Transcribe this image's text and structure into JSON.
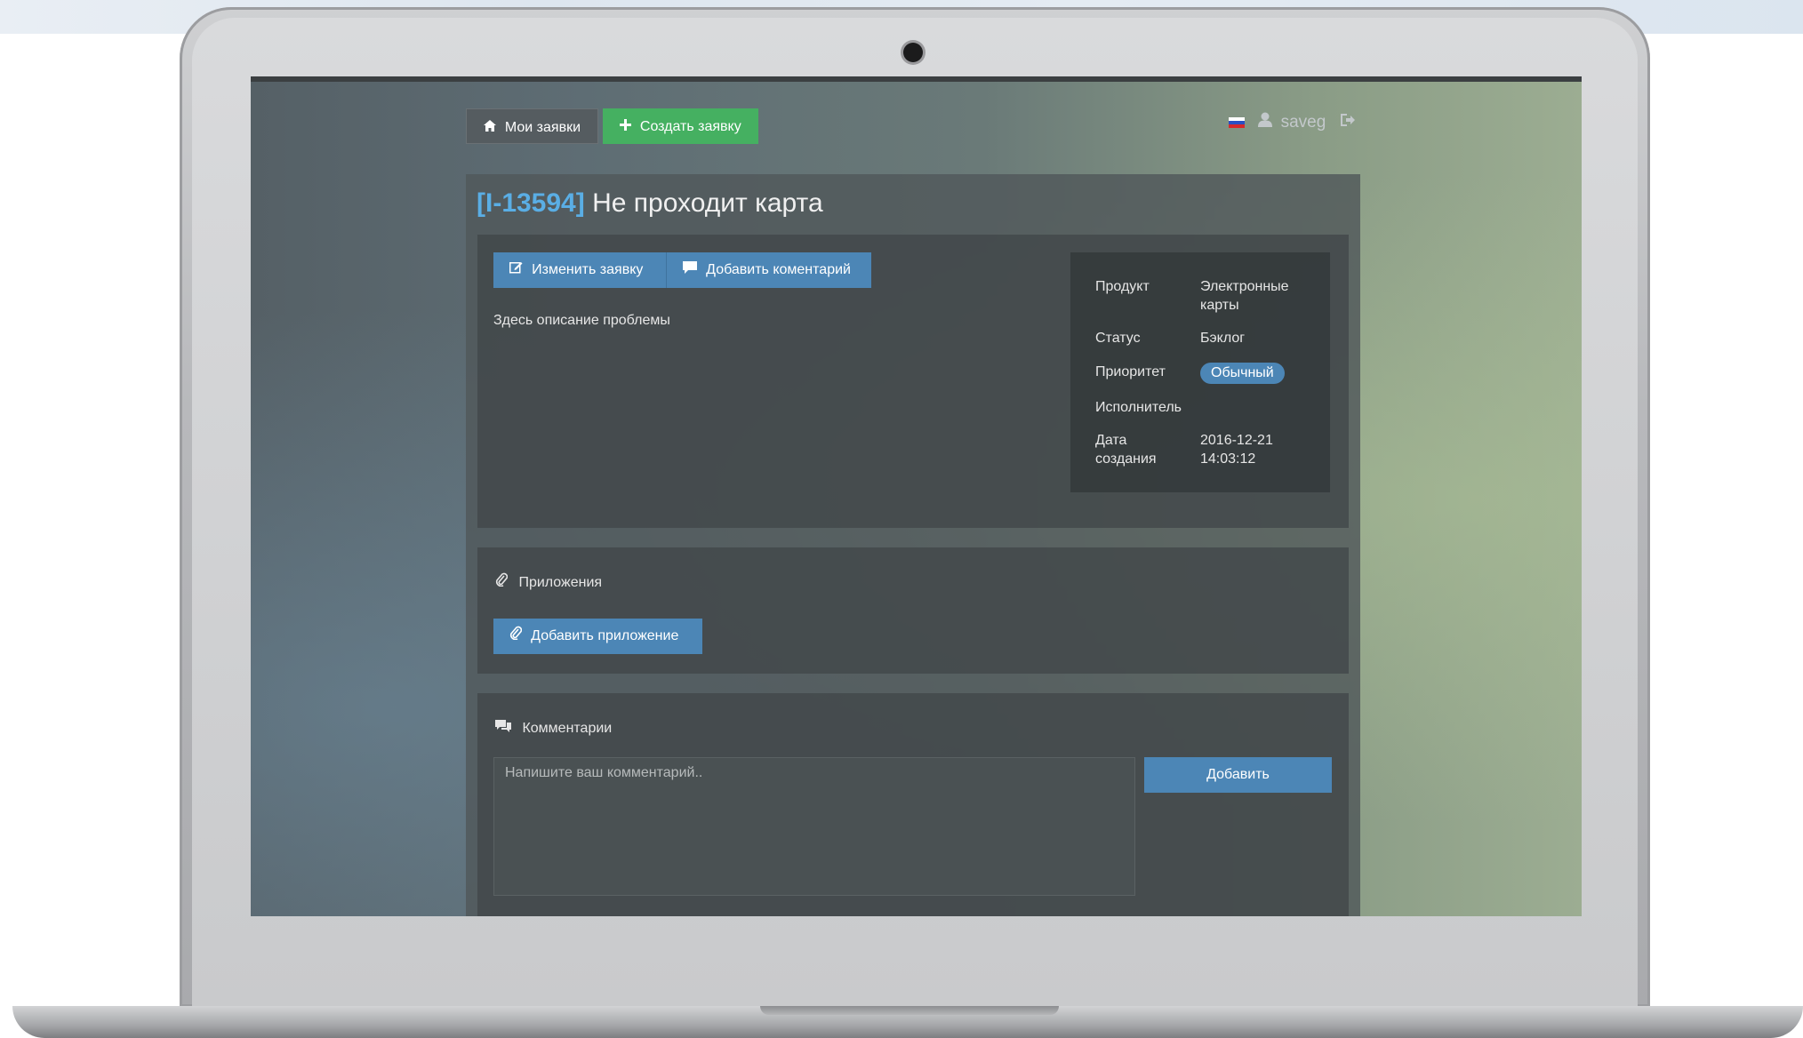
{
  "nav": {
    "my_requests": "Мои заявки",
    "create_request": "Создать заявку",
    "username": "saveg"
  },
  "ticket": {
    "id": "[I-13594]",
    "title": "Не проходит карта",
    "edit_button": "Изменить заявку",
    "comment_button": "Добавить коментарий",
    "description": "Здесь описание проблемы"
  },
  "properties": {
    "product_label": "Продукт",
    "product_value": "Электронные карты",
    "status_label": "Статус",
    "status_value": "Бэклог",
    "priority_label": "Приоритет",
    "priority_value": "Обычный",
    "assignee_label": "Исполнитель",
    "created_label": "Дата создания",
    "created_value": "2016-12-21 14:03:12"
  },
  "attachments": {
    "heading": "Приложения",
    "add_button": "Добавить приложение"
  },
  "comments": {
    "heading": "Комментарии",
    "placeholder": "Напишите ваш комментарий..",
    "add_button": "Добавить"
  },
  "colors": {
    "accent_blue": "#4c86b6",
    "accent_green": "#45b061",
    "id_blue": "#5aaee5"
  },
  "icons": [
    "home-icon",
    "plus-icon",
    "flag-ru-icon",
    "user-icon",
    "logout-icon",
    "edit-icon",
    "comment-icon",
    "paperclip-icon",
    "comments-icon"
  ]
}
